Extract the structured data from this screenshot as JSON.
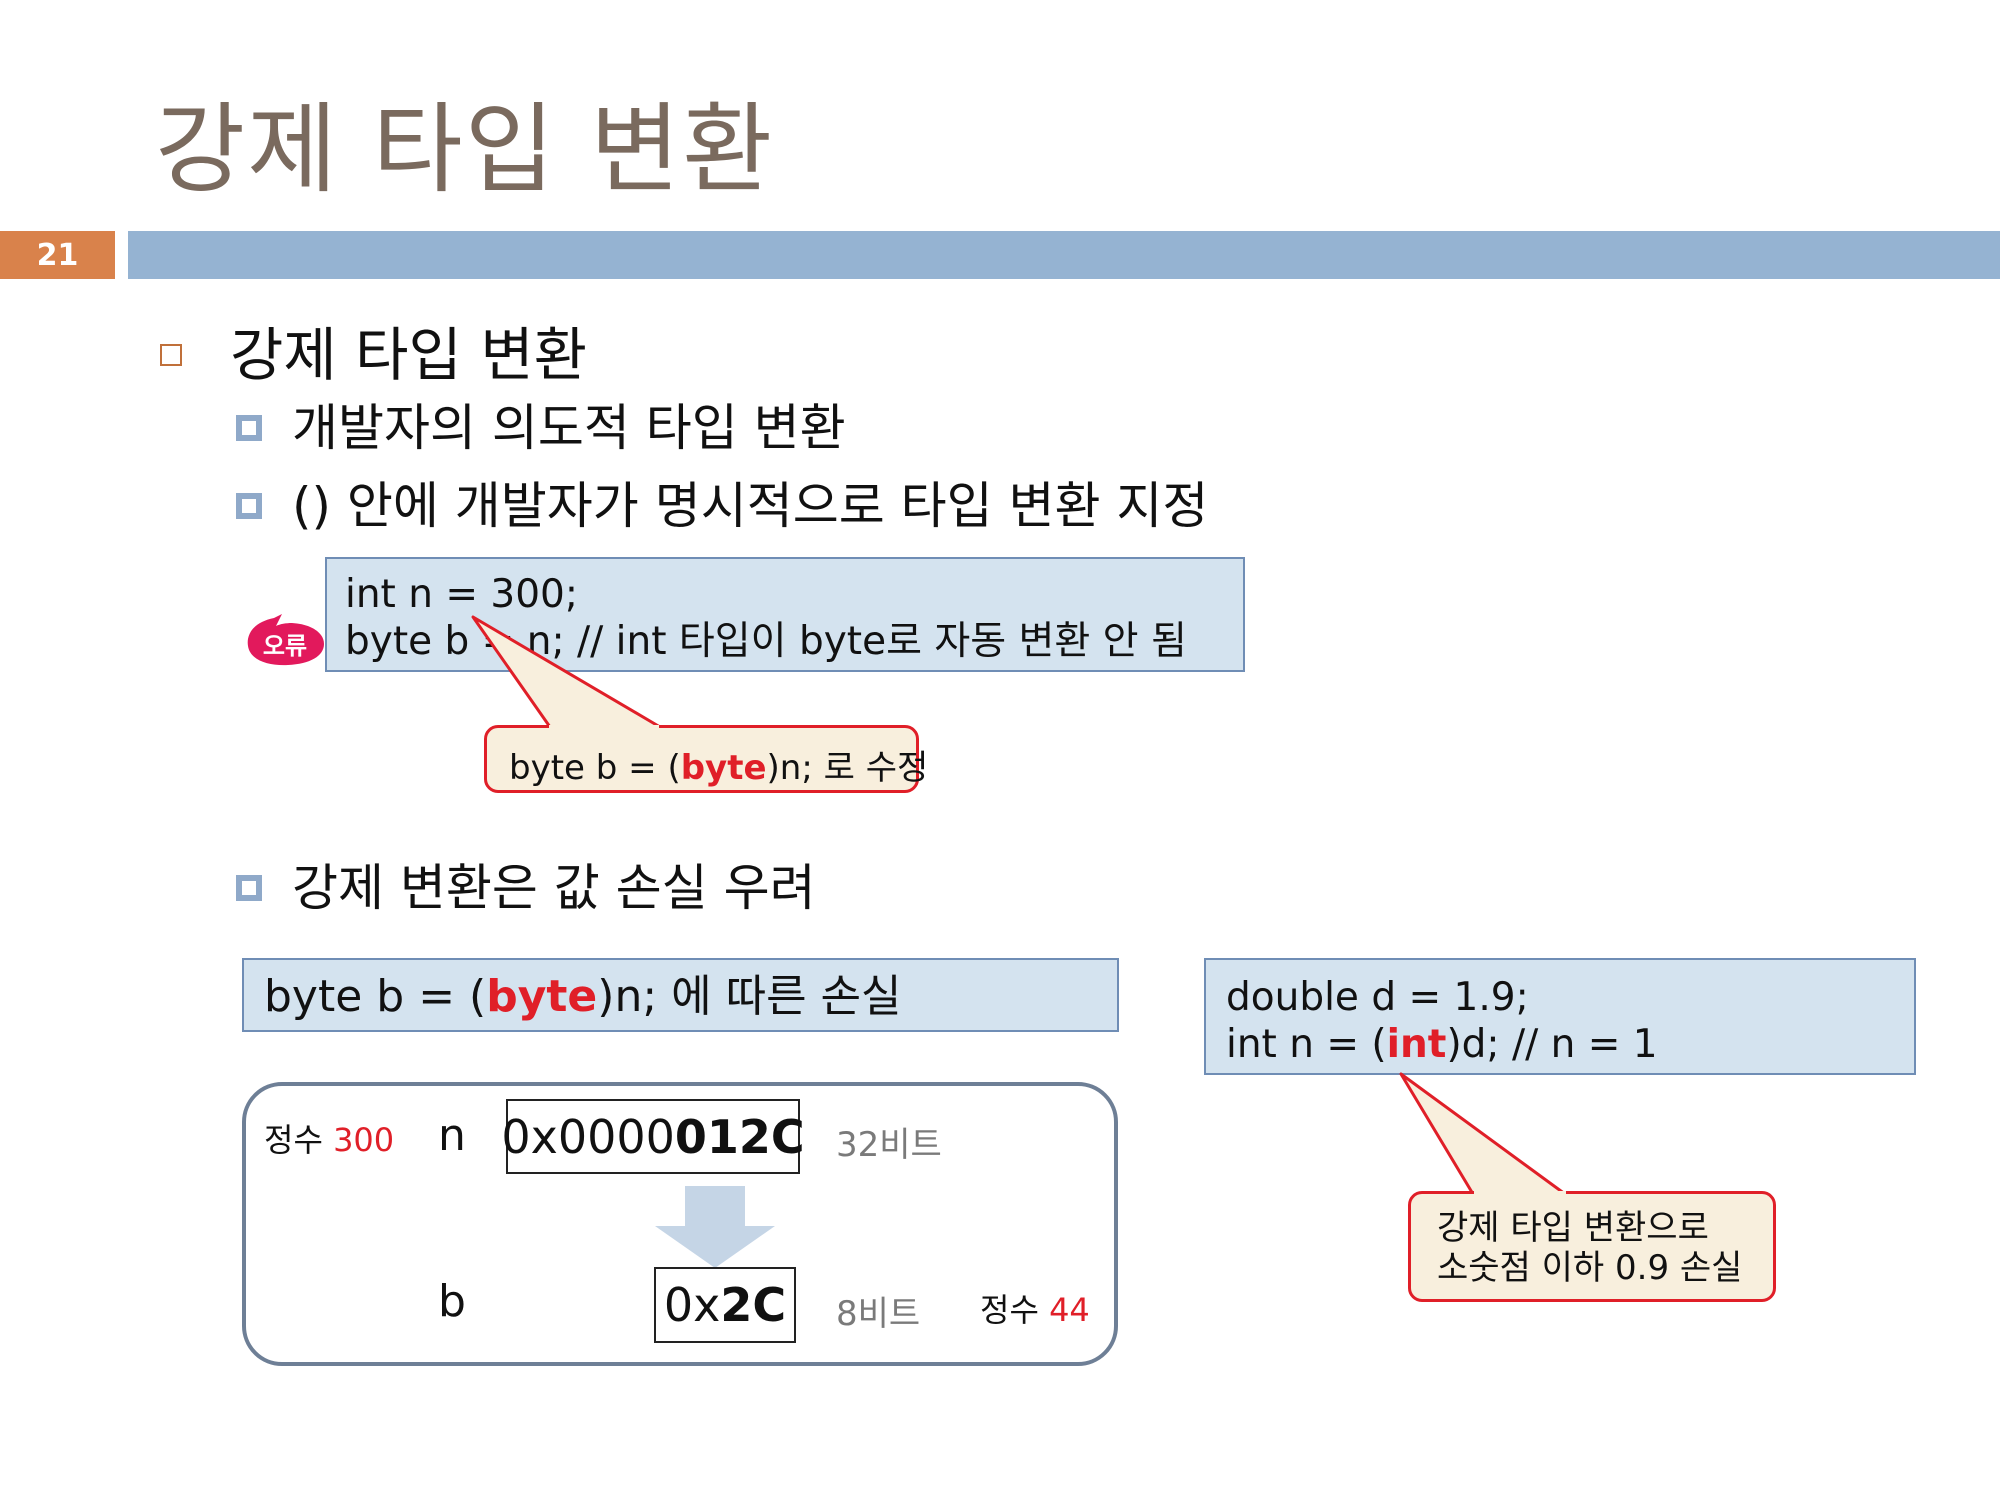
{
  "slide": {
    "title": "강제 타입 변환",
    "page_number": "21"
  },
  "bullets": {
    "main": "강제 타입 변환",
    "sub1": "개발자의 의도적 타입 변환",
    "sub2": "() 안에 개발자가 명시적으로 타입 변환 지정",
    "sub3": "강제 변환은 값 손실 우려"
  },
  "code_example1": {
    "line1": "int n = 300;",
    "line2": "byte b = n; // int 타입이 byte로 자동 변환 안 됨",
    "error_badge": "오류"
  },
  "callout1": {
    "prefix": "byte b = (",
    "keyword": "byte",
    "suffix": ")n; 로 수정"
  },
  "loss_box": {
    "prefix": "byte b = (",
    "keyword": "byte",
    "suffix": ")n; 에 따른 손실"
  },
  "memory": {
    "n_label_prefix": "정수",
    "n_value": "300",
    "n_var": "n",
    "n_hex_prefix": "0x0000",
    "n_hex_bold": "012C",
    "n_bits": "32비트",
    "b_var": "b",
    "b_hex_prefix": "0x",
    "b_hex_bold": "2C",
    "b_bits": "8비트",
    "b_label_prefix": "정수",
    "b_value": "44"
  },
  "code_example2": {
    "line1": "double d = 1.9;",
    "line2_prefix": "int n = (",
    "line2_keyword": "int",
    "line2_suffix": ")d;  // n = 1"
  },
  "callout2": {
    "line1": "강제 타입 변환으로",
    "line2": "소숫점 이하 0.9 손실"
  },
  "colors": {
    "title": "#7a6a5e",
    "page_number_bg": "#d9824b",
    "title_bar": "#95b3d2",
    "code_bg": "#d4e3ef",
    "callout_bg": "#f8efdd",
    "accent_red": "#e01f28"
  }
}
